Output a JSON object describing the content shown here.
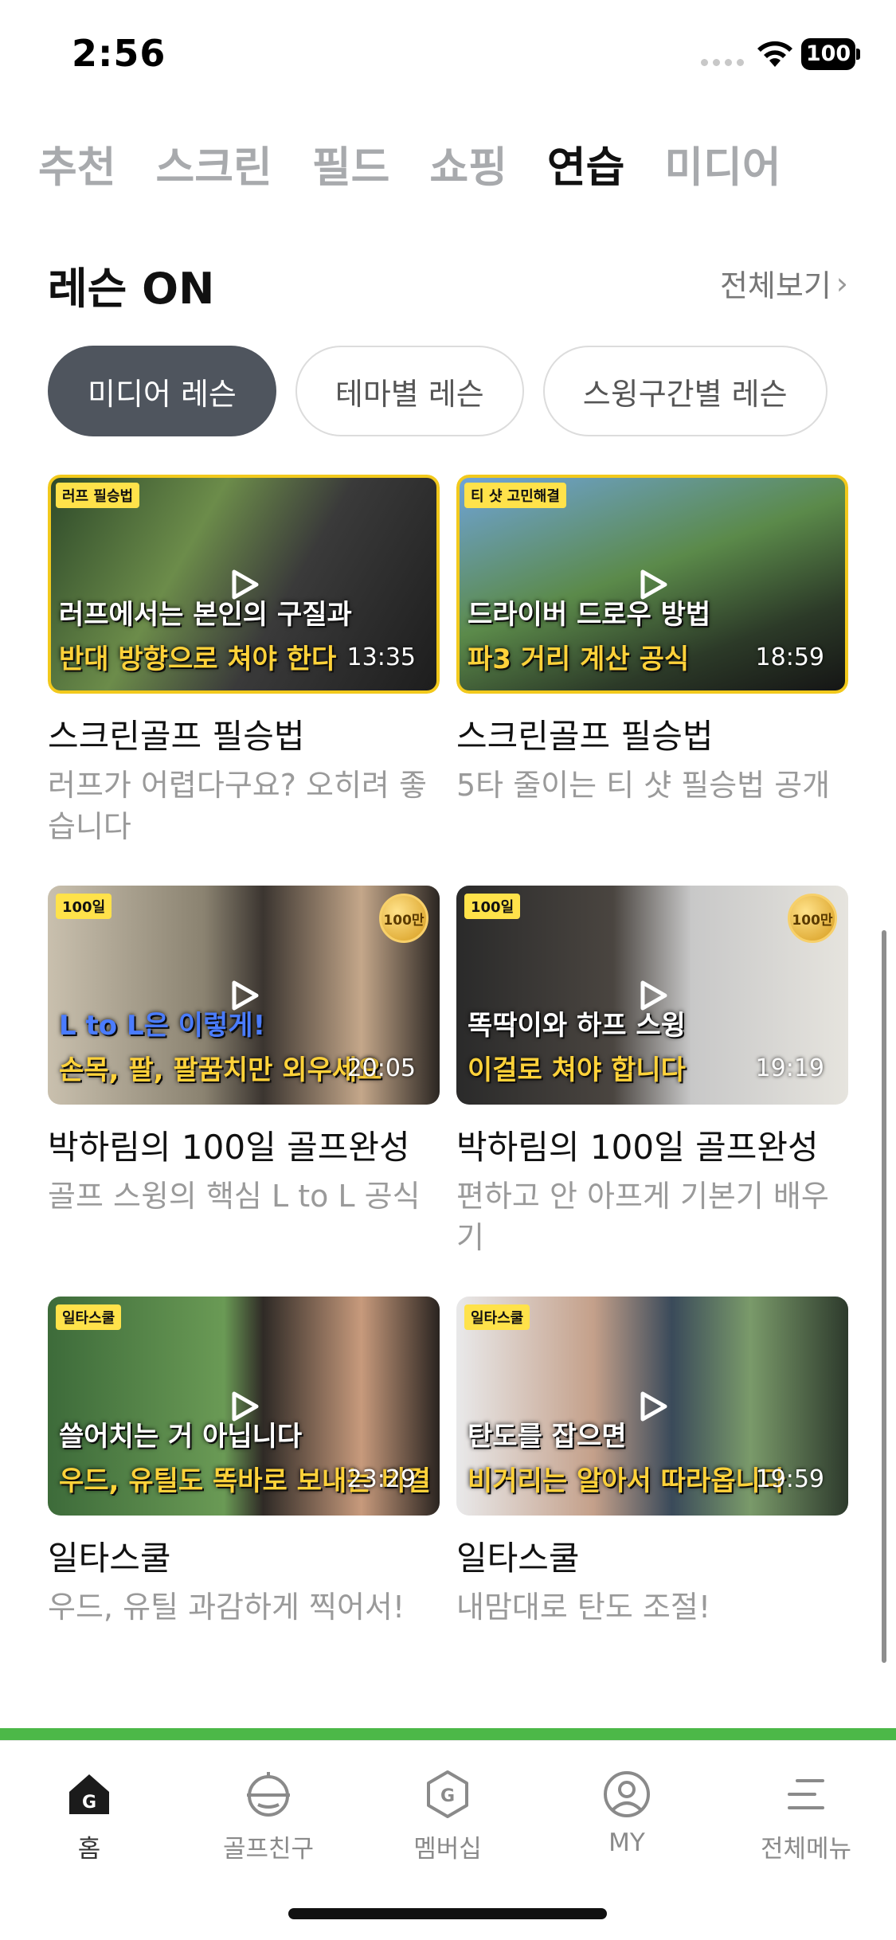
{
  "status_bar": {
    "time": "2:56",
    "battery": "100"
  },
  "category_tabs": [
    {
      "label": "추천",
      "active": false
    },
    {
      "label": "스크린",
      "active": false
    },
    {
      "label": "필드",
      "active": false
    },
    {
      "label": "쇼핑",
      "active": false
    },
    {
      "label": "연습",
      "active": true
    },
    {
      "label": "미디어",
      "active": false
    }
  ],
  "section": {
    "title": "레슨 ON",
    "view_all": "전체보기"
  },
  "chips": [
    {
      "label": "미디어 레슨",
      "active": true
    },
    {
      "label": "테마별 레슨",
      "active": false
    },
    {
      "label": "스윙구간별 레슨",
      "active": false
    }
  ],
  "videos": [
    {
      "title": "스크린골프 필승법",
      "subtitle": "러프가 어렵다구요? 오히려 좋습니다",
      "duration": "13:35",
      "tag": "러프 필승법",
      "caption1": "러프에서는 본인의 구질과",
      "caption2": "반대 방향으로 쳐야 한다",
      "badge": ""
    },
    {
      "title": "스크린골프 필승법",
      "subtitle": "5타 줄이는 티 샷 필승법 공개",
      "duration": "18:59",
      "tag": "티 샷 고민해결",
      "caption1": "드라이버 드로우 방법",
      "caption2": "파3 거리 계산 공식",
      "badge": ""
    },
    {
      "title": "박하림의 100일 골프완성",
      "subtitle": "골프 스윙의 핵심 L to L 공식",
      "duration": "20:05",
      "tag": "100일",
      "caption1": "L to L은 이렇게!",
      "caption2": "손목, 팔, 팔꿈치만 외우세요",
      "badge": "100만"
    },
    {
      "title": "박하림의 100일 골프완성",
      "subtitle": "편하고 안 아프게 기본기 배우기",
      "duration": "19:19",
      "tag": "100일",
      "caption1": "똑딱이와 하프 스윙",
      "caption2": "이걸로 쳐야 합니다",
      "badge": "100만"
    },
    {
      "title": "일타스쿨",
      "subtitle": "우드, 유틸 과감하게 찍어서!",
      "duration": "23:29",
      "tag": "일타스쿨",
      "caption1": "쓸어치는 거 아닙니다",
      "caption2": "우드, 유틸도 똑바로 보내는 비결",
      "badge": ""
    },
    {
      "title": "일타스쿨",
      "subtitle": "내맘대로 탄도 조절!",
      "duration": "19:59",
      "tag": "일타스쿨",
      "caption1": "탄도를 잡으면",
      "caption2": "비거리는 알아서 따라옵니다",
      "badge": ""
    }
  ],
  "bottom_nav": [
    {
      "label": "홈",
      "icon": "home-g-icon",
      "active": true
    },
    {
      "label": "골프친구",
      "icon": "golf-friend-icon",
      "active": false
    },
    {
      "label": "멤버십",
      "icon": "membership-icon",
      "active": false
    },
    {
      "label": "MY",
      "icon": "my-profile-icon",
      "active": false
    },
    {
      "label": "전체메뉴",
      "icon": "menu-icon",
      "active": false
    }
  ],
  "colors": {
    "accent_green": "#4cb848",
    "chip_active": "#4f555e",
    "caption_yellow": "#ffd23a"
  }
}
